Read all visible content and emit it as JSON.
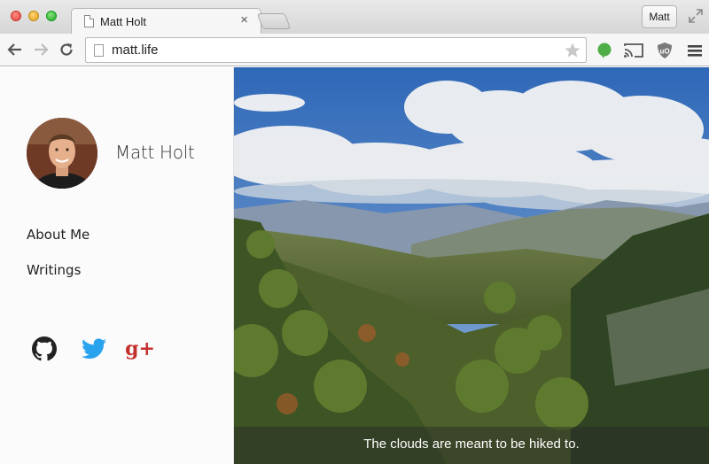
{
  "browser": {
    "tab_title": "Matt Holt",
    "tab_close_glyph": "×",
    "url": "matt.life",
    "profile_label": "Matt"
  },
  "icons": {
    "back": "back-arrow-icon",
    "forward": "forward-arrow-icon",
    "reload": "reload-icon",
    "star": "star-icon",
    "evernote": "evernote-icon",
    "cast": "cast-icon",
    "ublock": "ublock-icon",
    "menu": "hamburger-menu-icon"
  },
  "sidebar": {
    "name": "Matt Holt",
    "nav": [
      {
        "label": "About Me"
      },
      {
        "label": "Writings"
      }
    ],
    "social": [
      {
        "name": "github",
        "icon": "github-icon",
        "color": "#222222"
      },
      {
        "name": "twitter",
        "icon": "twitter-icon",
        "color": "#2aa3ef"
      },
      {
        "name": "google-plus",
        "icon": "google-plus-icon",
        "color": "#c4302b",
        "glyph": "g+"
      }
    ]
  },
  "hero": {
    "caption": "The clouds are meant to be hiked to."
  },
  "colors": {
    "sidebar_bg": "#fbfbfb",
    "sky": "#4a7fc0",
    "forest": "#3f5a28"
  }
}
